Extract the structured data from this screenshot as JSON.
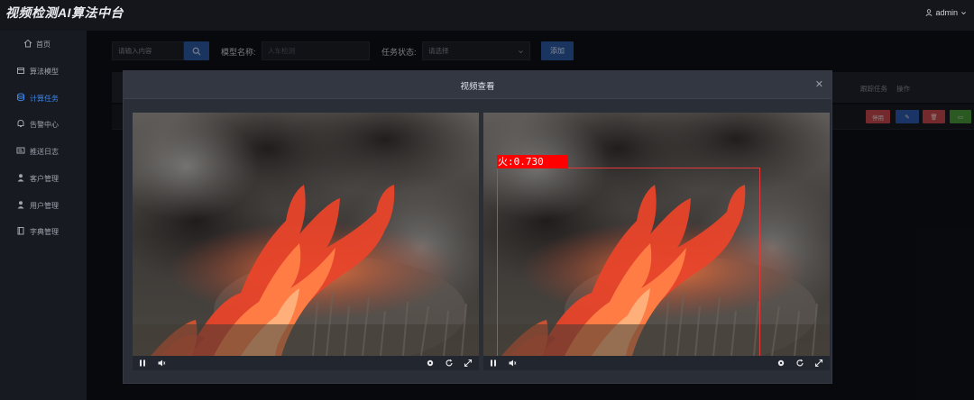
{
  "app": {
    "title": "视频检测AI算法中台",
    "user": "admin"
  },
  "sidebar": {
    "items": [
      {
        "label": "首页",
        "icon": "home-icon"
      },
      {
        "label": "算法模型",
        "icon": "cube-icon"
      },
      {
        "label": "计算任务",
        "icon": "database-icon",
        "active": true
      },
      {
        "label": "告警中心",
        "icon": "bell-icon"
      },
      {
        "label": "推送日志",
        "icon": "message-icon"
      },
      {
        "label": "客户管理",
        "icon": "user-icon"
      },
      {
        "label": "用户管理",
        "icon": "user-icon"
      },
      {
        "label": "字典管理",
        "icon": "book-icon"
      }
    ]
  },
  "filters": {
    "keyword_placeholder": "请输入内容",
    "model_label": "模型名称:",
    "model_placeholder": "人车检测",
    "status_label": "任务状态:",
    "status_placeholder": "请选择",
    "add_label": "添加"
  },
  "table": {
    "headers": [
      "跟踪任务",
      "操作"
    ],
    "row_actions": [
      {
        "label": "停用",
        "color": "#c9484d"
      },
      {
        "label": "✎",
        "color": "#2d5ab0"
      },
      {
        "label": "🗑",
        "color": "#c9484d"
      },
      {
        "label": "▭",
        "color": "#4a9a3c"
      }
    ]
  },
  "modal": {
    "title": "视频查看",
    "close_icon": "close-icon",
    "players": [
      {
        "name": "original",
        "has_detection": false
      },
      {
        "name": "detected",
        "has_detection": true,
        "detection_label": "火:0.730"
      }
    ]
  },
  "colors": {
    "accent": "#3f84e5",
    "primary_button": "#2e5aa5",
    "detection": "#ff0000"
  }
}
